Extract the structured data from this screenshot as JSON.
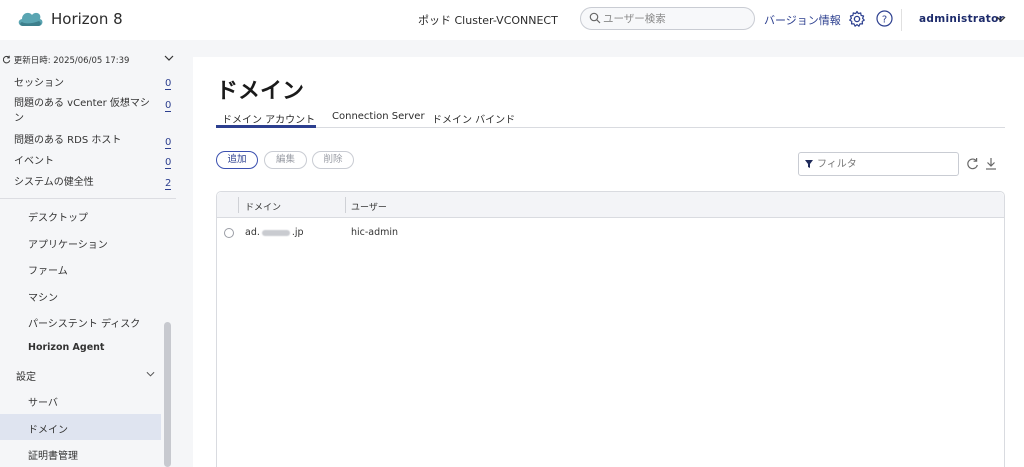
{
  "header": {
    "app_title": "Horizon 8",
    "pod_label": "ポッド",
    "pod_name": "Cluster-VCONNECT",
    "search_placeholder": "ユーザー検索",
    "version_link": "バージョン情報",
    "user": "administrator",
    "colors": {
      "accent": "#2c3f8f",
      "logo": "#5aa5b2"
    }
  },
  "sidebar": {
    "updated": "更新日時: 2025/06/05 17:39",
    "stats": [
      {
        "label": "セッション",
        "count": "0"
      },
      {
        "label": "問題のある vCenter 仮想マシン",
        "count": "0"
      },
      {
        "label": "問題のある RDS ホスト",
        "count": "0"
      },
      {
        "label": "イベント",
        "count": "0"
      },
      {
        "label": "システムの健全性",
        "count": "2"
      }
    ],
    "nav": [
      {
        "label": "デスクトップ"
      },
      {
        "label": "アプリケーション"
      },
      {
        "label": "ファーム"
      },
      {
        "label": "マシン"
      },
      {
        "label": "パーシステント ディスク"
      },
      {
        "label": "Horizon Agent"
      }
    ],
    "settings_section": "設定",
    "settings_items": [
      {
        "label": "サーバ"
      },
      {
        "label": "ドメイン"
      },
      {
        "label": "証明書管理"
      }
    ]
  },
  "main": {
    "title": "ドメイン",
    "tabs": [
      {
        "label": "ドメイン アカウント",
        "active": true
      },
      {
        "label": "Connection Server",
        "active": false
      },
      {
        "label": "ドメイン バインド",
        "active": false
      }
    ],
    "buttons": {
      "add": "追加",
      "edit": "編集",
      "delete": "削除"
    },
    "filter_placeholder": "フィルタ",
    "table": {
      "columns": [
        "ドメイン",
        "ユーザー"
      ],
      "rows": [
        {
          "domain_prefix": "ad.",
          "domain_suffix": ".jp",
          "user": "hic-admin"
        }
      ]
    }
  }
}
